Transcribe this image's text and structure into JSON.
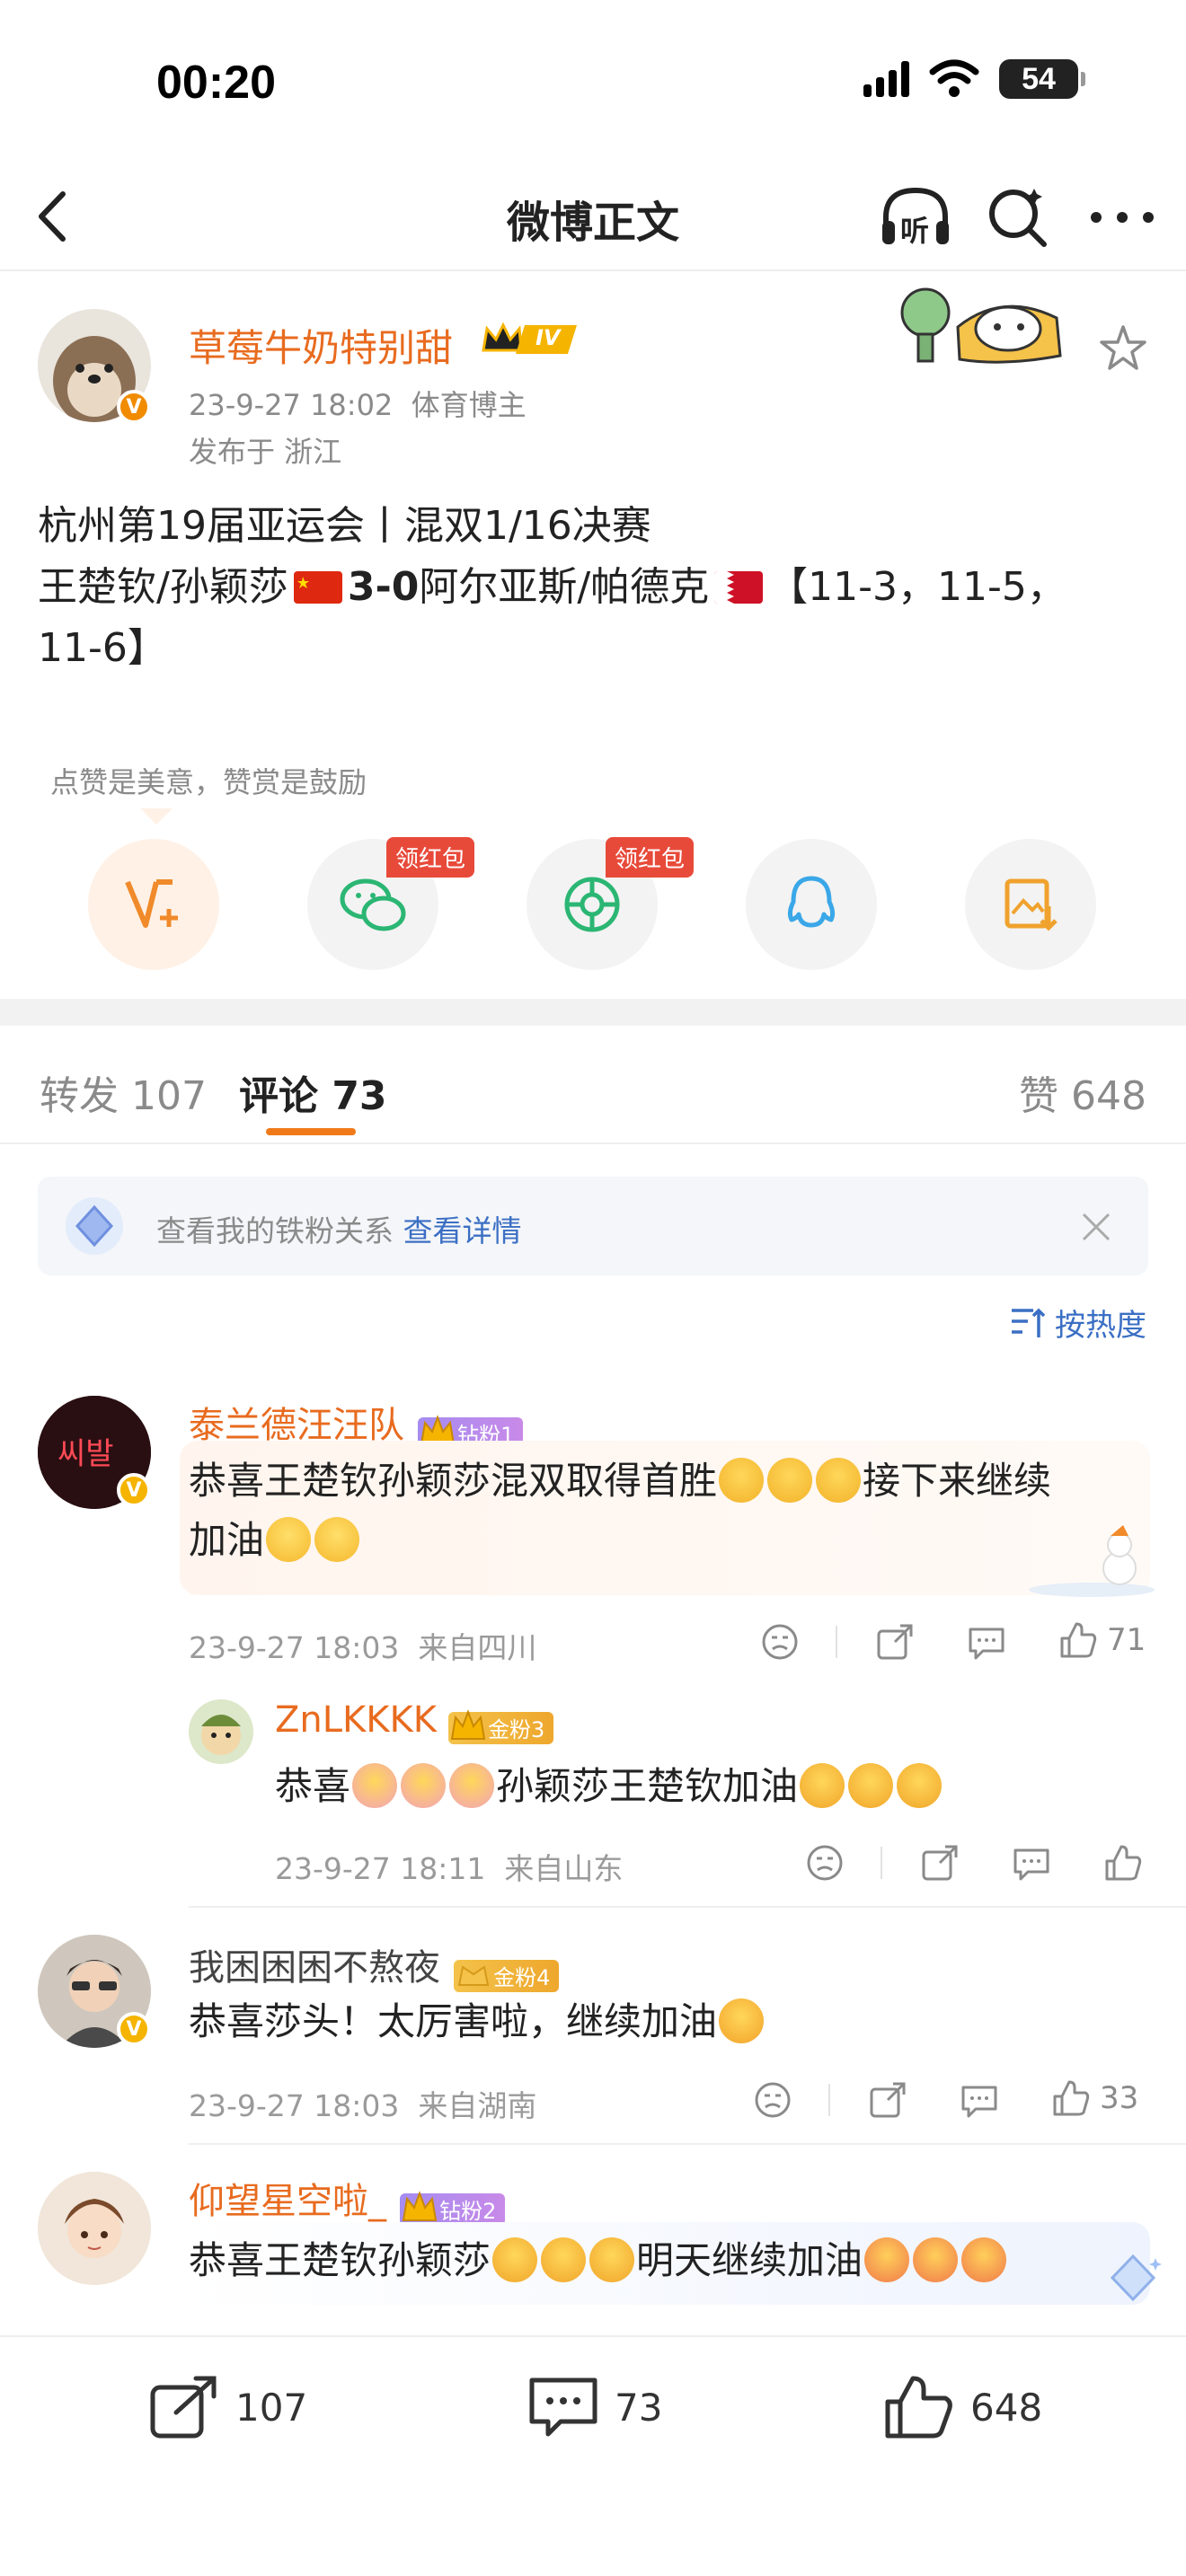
{
  "status_bar": {
    "time": "00:20",
    "battery": "54"
  },
  "nav": {
    "title": "微博正文",
    "listen_label": "听"
  },
  "post": {
    "author": "草莓牛奶特别甜",
    "level_badge": "IV",
    "date": "23-9-27 18:02",
    "author_type": "体育博主",
    "location": "发布于 浙江",
    "line1": "杭州第19届亚运会丨混双1/16决赛",
    "line2_a": "王楚钦/孙颖莎",
    "line2_score": "3-0",
    "line2_b": "阿尔亚斯/帕德克",
    "line2_c": "【11-3，11-5，",
    "line3": "11-6】",
    "reward_hint": "点赞是美意，赞赏是鼓励",
    "share_badge": "领红包"
  },
  "tabs": {
    "repost": "转发 107",
    "comment": "评论 73",
    "like": "赞 648"
  },
  "fans_banner": {
    "text": "查看我的铁粉关系",
    "link": "查看详情"
  },
  "sort": {
    "label": "按热度"
  },
  "comments": [
    {
      "name": "泰兰德汪汪队",
      "badge": "钻粉1",
      "text_a": "恭喜王楚钦孙颖莎混双取得首胜",
      "text_b": "接下来继续",
      "text_c": "加油",
      "time": "23-9-27 18:03",
      "from": "来自四川",
      "likes": "71",
      "reply": {
        "name": "ZnLKKKK",
        "badge": "金粉3",
        "text_a": "恭喜",
        "text_b": "孙颖莎王楚钦加油",
        "time": "23-9-27 18:11",
        "from": "来自山东"
      }
    },
    {
      "name": "我困困困不熬夜",
      "badge": "金粉4",
      "text": "恭喜莎头！太厉害啦，继续加油",
      "time": "23-9-27 18:03",
      "from": "来自湖南",
      "likes": "33"
    },
    {
      "name": "仰望星空啦_",
      "badge": "钻粉2",
      "text_a": "恭喜王楚钦孙颖莎",
      "text_b": "明天继续加油"
    }
  ],
  "bottom_bar": {
    "reposts": "107",
    "comments": "73",
    "likes": "648"
  },
  "colors": {
    "accent": "#e86b1f",
    "link": "#3b6fc4",
    "tab_underline": "#f07a1a"
  }
}
